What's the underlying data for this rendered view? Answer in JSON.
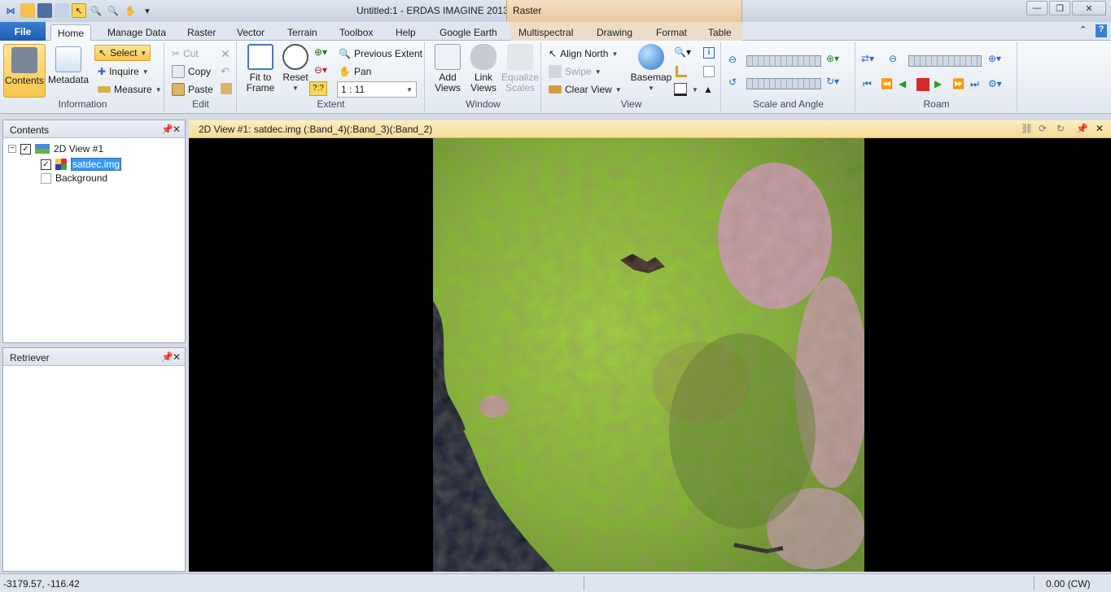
{
  "window": {
    "title": "Untitled:1 - ERDAS IMAGINE 2013",
    "context_tab_title": "Raster"
  },
  "tabs": {
    "file": "File",
    "items": [
      "Home",
      "Manage Data",
      "Raster",
      "Vector",
      "Terrain",
      "Toolbox",
      "Help",
      "Google Earth",
      "Multispectral",
      "Drawing",
      "Format",
      "Table"
    ],
    "active": "Home"
  },
  "ribbon": {
    "information": {
      "label": "Information",
      "contents": "Contents",
      "metadata": "Metadata",
      "select": "Select",
      "inquire": "Inquire",
      "measure": "Measure"
    },
    "edit": {
      "label": "Edit",
      "cut": "Cut",
      "copy": "Copy",
      "paste": "Paste"
    },
    "extent": {
      "label": "Extent",
      "fit_to_frame": "Fit to\nFrame",
      "fit1": "Fit to",
      "fit2": "Frame",
      "reset": "Reset",
      "previous_extent": "Previous Extent",
      "pan": "Pan",
      "scale_value": "1 : 11"
    },
    "window": {
      "label": "Window",
      "add1": "Add",
      "add2": "Views",
      "link1": "Link",
      "link2": "Views",
      "eq1": "Equalize",
      "eq2": "Scales"
    },
    "view": {
      "label": "View",
      "align_north": "Align North",
      "swipe": "Swipe",
      "clear_view": "Clear View",
      "basemap": "Basemap"
    },
    "scale_angle": {
      "label": "Scale and Angle"
    },
    "roam": {
      "label": "Roam"
    }
  },
  "contents_panel": {
    "title": "Contents",
    "items": [
      {
        "label": "2D View #1",
        "checked": true
      },
      {
        "label": "satdec.img",
        "checked": true,
        "selected": true
      },
      {
        "label": "Background",
        "checked": false
      }
    ]
  },
  "retriever_panel": {
    "title": "Retriever"
  },
  "view": {
    "title": "2D View #1: satdec.img (:Band_4)(:Band_3)(:Band_2)"
  },
  "status": {
    "coords": "-3179.57, -116.42",
    "rotation": "0.00 (CW)"
  },
  "colors": {
    "accent": "#1d5cb0",
    "context_tab": "#e9c79e",
    "view_header": "#f6dd96",
    "selected": "#3399ff"
  }
}
